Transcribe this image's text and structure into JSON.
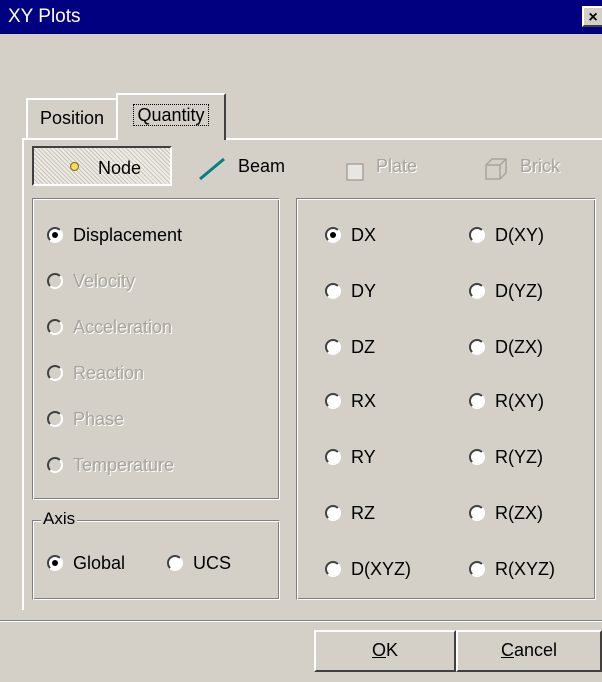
{
  "window": {
    "title": "XY Plots",
    "close_glyph": "×"
  },
  "tabs": [
    {
      "label": "Position",
      "active": false
    },
    {
      "label": "Quantity",
      "active": true
    }
  ],
  "element_types": [
    {
      "label": "Node",
      "icon": "node-dot-icon",
      "selected": true,
      "enabled": true
    },
    {
      "label": "Beam",
      "icon": "beam-line-icon",
      "selected": false,
      "enabled": true
    },
    {
      "label": "Plate",
      "icon": "plate-square-icon",
      "selected": false,
      "enabled": false
    },
    {
      "label": "Brick",
      "icon": "brick-cube-icon",
      "selected": false,
      "enabled": false
    }
  ],
  "quantity": {
    "options": [
      {
        "label": "Displacement",
        "checked": true,
        "enabled": true
      },
      {
        "label": "Velocity",
        "checked": false,
        "enabled": false
      },
      {
        "label": "Acceleration",
        "checked": false,
        "enabled": false
      },
      {
        "label": "Reaction",
        "checked": false,
        "enabled": false
      },
      {
        "label": "Phase",
        "checked": false,
        "enabled": false
      },
      {
        "label": "Temperature",
        "checked": false,
        "enabled": false
      }
    ]
  },
  "axis": {
    "legend": "Axis",
    "options": [
      {
        "label": "Global",
        "checked": true
      },
      {
        "label": "UCS",
        "checked": false
      }
    ]
  },
  "components": {
    "left": [
      "DX",
      "DY",
      "DZ",
      "RX",
      "RY",
      "RZ",
      "D(XYZ)"
    ],
    "right": [
      "D(XY)",
      "D(YZ)",
      "D(ZX)",
      "R(XY)",
      "R(YZ)",
      "R(ZX)",
      "R(XYZ)"
    ],
    "selected": "DX"
  },
  "buttons": {
    "ok": {
      "mnemonic": "O",
      "rest": "K"
    },
    "cancel": {
      "mnemonic": "C",
      "rest": "ancel"
    }
  },
  "colors": {
    "title_bar": "#000080",
    "face": "#d4d0c8",
    "beam_icon": "#008080",
    "disabled_text": "#a8a49c"
  }
}
